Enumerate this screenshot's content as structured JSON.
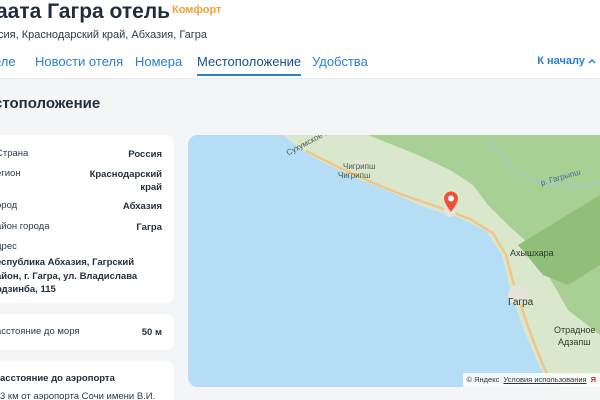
{
  "header": {
    "title": "аата Гагра отель",
    "badge": "Комфорт",
    "address": "сия, Краснодарский край, Абхазия, Гагра"
  },
  "tabs": [
    {
      "label": "еле"
    },
    {
      "label": "Новости отеля"
    },
    {
      "label": "Номера"
    },
    {
      "label": "Местоположение"
    },
    {
      "label": "Удобства"
    }
  ],
  "tabs_right": {
    "label": "К началу"
  },
  "section": {
    "title": "стоположение"
  },
  "location": {
    "country_label": "Страна",
    "country_value": "Россия",
    "region_label": "егион",
    "region_value_1": "Краснодарский",
    "region_value_2": "край",
    "city_label": "ород",
    "city_value": "Абхазия",
    "district_label": "айон города",
    "district_value": "Гагра",
    "address_label": "дрес",
    "address_line_1": "еспублика Абхазия, Гагрский",
    "address_line_2": "айон, г. Гагра, ул. Владислава",
    "address_line_3": "рдзинба, 115"
  },
  "sea": {
    "label": "асстояние до моря",
    "value": "50 м"
  },
  "airport": {
    "label": "асстояние до аэропорта",
    "value": "3 км от аэропорта Сочи имени В.И."
  },
  "map": {
    "labels": {
      "road": "Сухумское ш.",
      "chigripsh_1": "Чигрипш",
      "chigripsh_2": "Чигрипш",
      "river": "р. Гагрыпш",
      "akhyshara": "Ахышхара",
      "gagra": "Гагра",
      "otradnoe": "Отрадное",
      "adzapsh": "Адзапш"
    },
    "copyright": "© Яндекс",
    "terms": "Условия использования",
    "brand": "Я",
    "colors": {
      "sea": "#b6ddf6",
      "land": "#d7e6c9",
      "forest": "#9fc98a",
      "road": "#f2c58a",
      "pin": "#f0503a"
    }
  }
}
